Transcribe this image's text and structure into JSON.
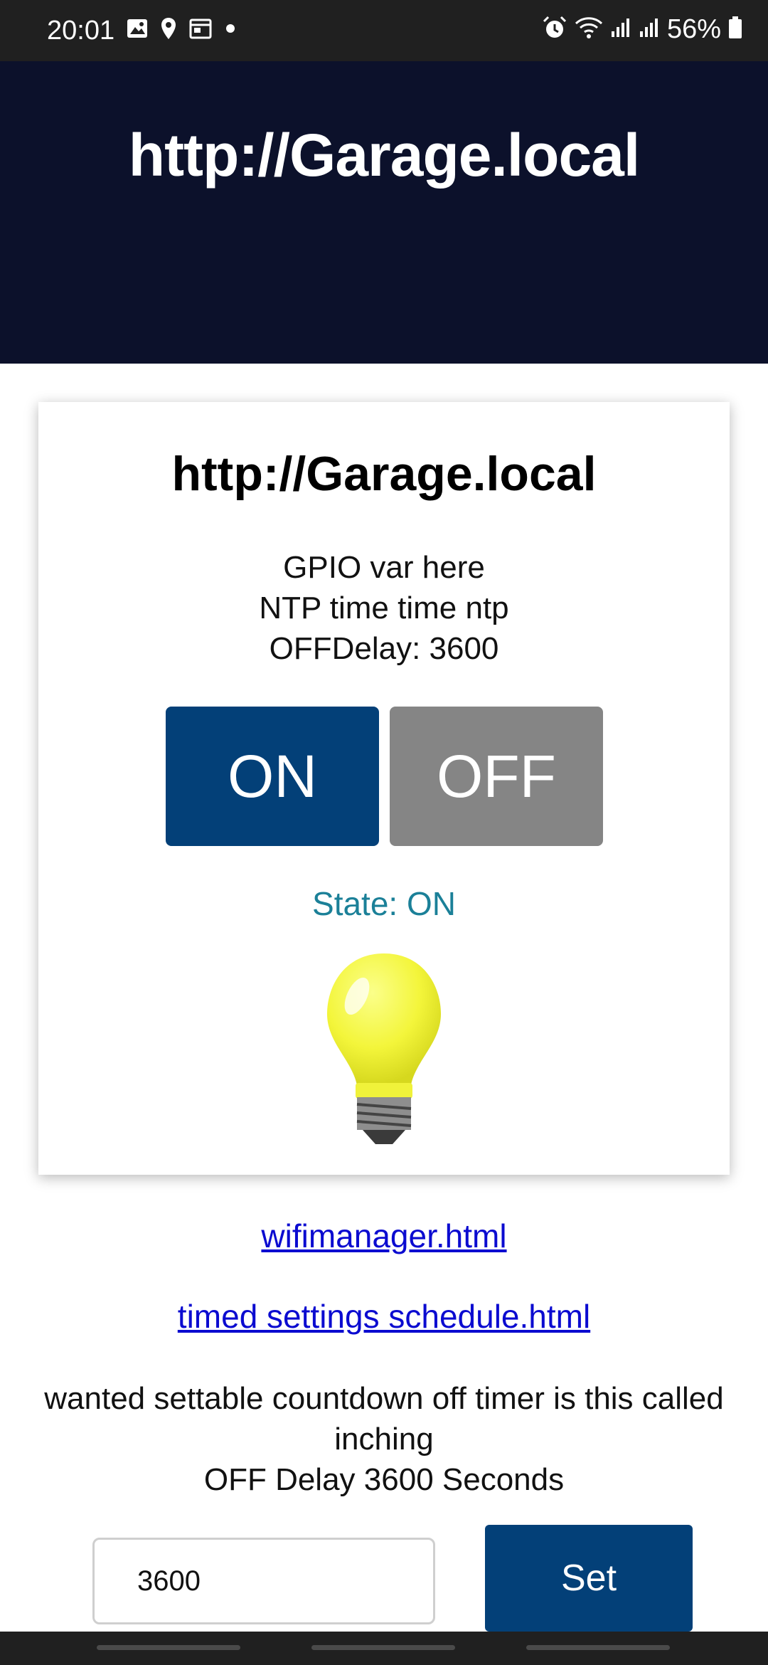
{
  "status_bar": {
    "time": "20:01",
    "left_icons": [
      "gallery-icon",
      "location-icon",
      "calendar-icon",
      "dot-icon"
    ],
    "right_icons": [
      "alarm-icon",
      "wifi-icon",
      "signal-icon",
      "signal-icon",
      "battery-icon"
    ],
    "battery": "56%"
  },
  "header": {
    "title": "http://Garage.local"
  },
  "card": {
    "title": "http://Garage.local",
    "gpio_text": "GPIO var here",
    "ntp_text": "NTP time time ntp",
    "offdelay_text": "OFFDelay: 3600",
    "on_label": "ON",
    "off_label": "OFF",
    "state_text": "State: ON",
    "bulb_icon": "light-bulb-icon"
  },
  "links": {
    "wifimanager": "wifimanager.html",
    "timed_settings": "timed settings schedule.html"
  },
  "description": {
    "line1": "wanted settable countdown off timer is this called inching",
    "line2": "OFF Delay 3600 Seconds"
  },
  "form": {
    "input_value": "3600",
    "set_label": "Set"
  },
  "colors": {
    "header_bg": "#0c112b",
    "on_button": "#034078",
    "off_button": "#858585",
    "state_text": "#1b8098",
    "link": "#0b0bd0"
  }
}
